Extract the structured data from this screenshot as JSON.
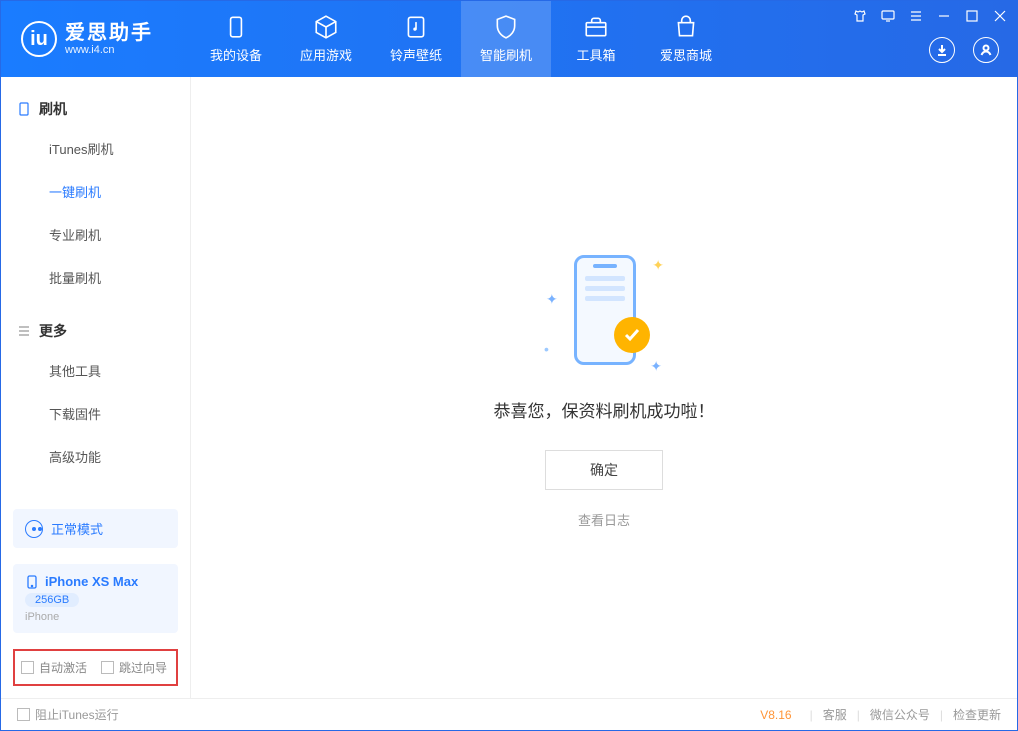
{
  "app": {
    "title": "爱思助手",
    "subtitle": "www.i4.cn"
  },
  "header_tabs": [
    {
      "label": "我的设备"
    },
    {
      "label": "应用游戏"
    },
    {
      "label": "铃声壁纸"
    },
    {
      "label": "智能刷机"
    },
    {
      "label": "工具箱"
    },
    {
      "label": "爱思商城"
    }
  ],
  "sidebar": {
    "section1_title": "刷机",
    "section1_items": [
      "iTunes刷机",
      "一键刷机",
      "专业刷机",
      "批量刷机"
    ],
    "section2_title": "更多",
    "section2_items": [
      "其他工具",
      "下载固件",
      "高级功能"
    ]
  },
  "mode": {
    "label": "正常模式"
  },
  "device": {
    "name": "iPhone XS Max",
    "capacity": "256GB",
    "type": "iPhone"
  },
  "options": {
    "auto_activate": "自动激活",
    "skip_guide": "跳过向导"
  },
  "main": {
    "success_text": "恭喜您，保资料刷机成功啦！",
    "ok_button": "确定",
    "view_log": "查看日志"
  },
  "footer": {
    "block_itunes": "阻止iTunes运行",
    "version": "V8.16",
    "support": "客服",
    "wechat": "微信公众号",
    "update": "检查更新"
  }
}
